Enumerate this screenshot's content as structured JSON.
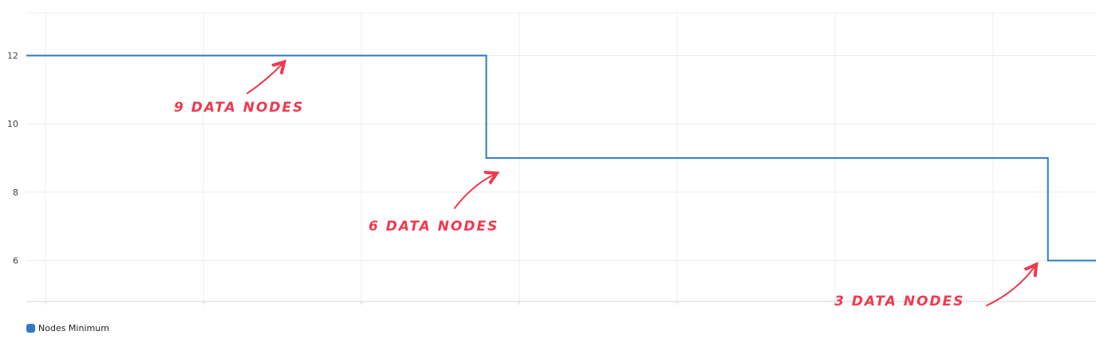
{
  "chart_data": {
    "type": "line",
    "step": true,
    "grid": true,
    "legend_position": "bottom-left",
    "ylim": [
      4.8,
      13.25
    ],
    "yticks": [
      "6",
      "8",
      "10",
      "12"
    ],
    "series": [
      {
        "name": "Nodes Minimum",
        "color": "#2f7bc2",
        "points": [
          {
            "x": 0.0,
            "y": 12
          },
          {
            "x": 0.43,
            "y": 12
          },
          {
            "x": 0.43,
            "y": 9
          },
          {
            "x": 0.955,
            "y": 9
          },
          {
            "x": 0.955,
            "y": 6
          },
          {
            "x": 1.0,
            "y": 6
          }
        ]
      }
    ],
    "annotations": [
      {
        "text": "9 DATA NODES",
        "color": "#f0394f"
      },
      {
        "text": "6 DATA NODES",
        "color": "#f0394f"
      },
      {
        "text": "3 DATA NODES",
        "color": "#f0394f"
      }
    ]
  }
}
